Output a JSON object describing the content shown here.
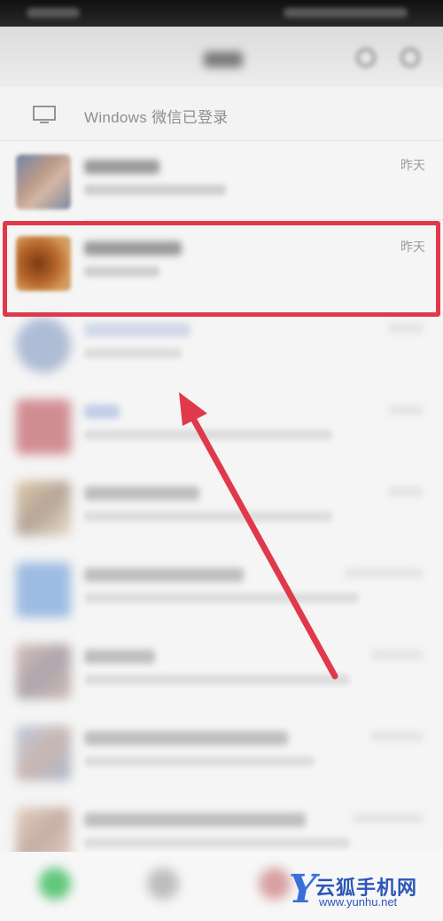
{
  "banner": {
    "text": "Windows 微信已登录",
    "icon": "monitor-icon"
  },
  "chats": [
    {
      "time": "昨天"
    },
    {
      "time": "昨天"
    }
  ],
  "watermark": {
    "letter": "Y",
    "title": "云狐手机网",
    "url": "www.yunhu.net"
  },
  "colors": {
    "highlight": "#e0394b",
    "watermark": "#2c56b8"
  }
}
